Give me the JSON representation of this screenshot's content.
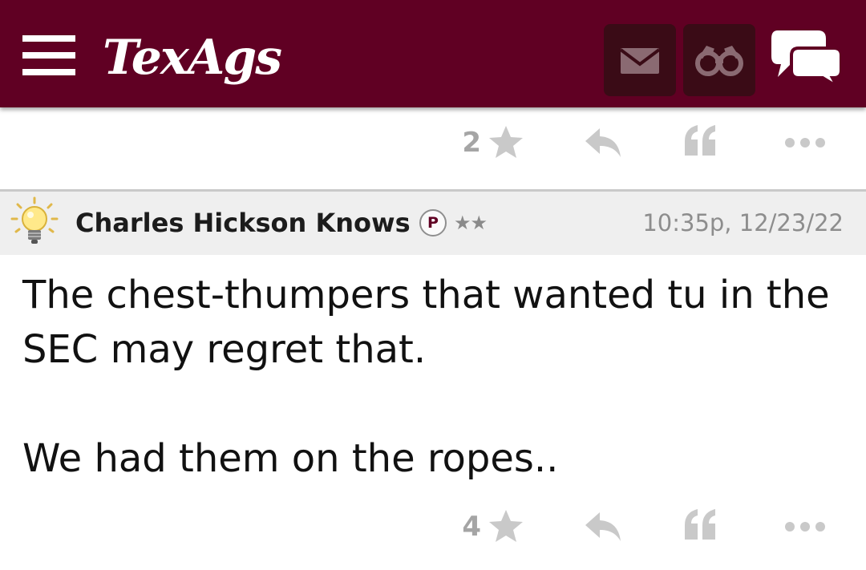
{
  "header": {
    "logo_text": "TexAgs",
    "background_color": "#600023",
    "icons": [
      "menu-icon",
      "mail-icon",
      "binoculars-icon",
      "chat-icon"
    ]
  },
  "previous_post": {
    "star_count": "2"
  },
  "post": {
    "username": "Charles Hickson Knows",
    "badge": "P",
    "rank_stars": "★★",
    "timestamp": "10:35p, 12/23/22",
    "body": {
      "line1": "The chest-thumpers that wanted tu in the",
      "line2": "SEC may regret that.",
      "line3": "We had them on the ropes.."
    },
    "star_count": "4"
  },
  "action_icons": [
    "star-icon",
    "reply-icon",
    "quote-icon",
    "more-icon"
  ]
}
